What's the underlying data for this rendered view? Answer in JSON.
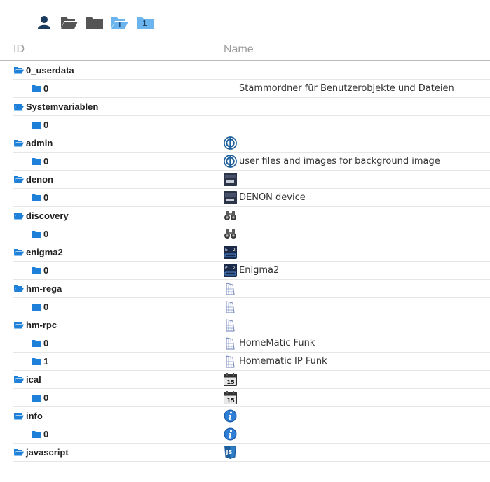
{
  "toolbar": {
    "buttons": [
      {
        "icon": "user-icon"
      },
      {
        "icon": "folder-open-icon"
      },
      {
        "icon": "folder-icon"
      },
      {
        "icon": "folder-open-icon"
      },
      {
        "icon": "folder-icon",
        "label": "1"
      }
    ]
  },
  "columns": {
    "id": "ID",
    "name": "Name"
  },
  "colors": {
    "folder_blue": "#1e80d8",
    "dark_folder": "#555555",
    "light_folder": "#6bb4ee"
  },
  "rows": [
    {
      "id": "0_userdata",
      "level": 0,
      "icon": "",
      "name": ""
    },
    {
      "id": "0",
      "level": 1,
      "icon": "",
      "name": "Stammordner für Benutzerobjekte und Dateien"
    },
    {
      "id": "Systemvariablen",
      "level": 0,
      "icon": "",
      "name": ""
    },
    {
      "id": "0",
      "level": 1,
      "icon": "",
      "name": ""
    },
    {
      "id": "admin",
      "level": 0,
      "icon": "admin-icon",
      "name": ""
    },
    {
      "id": "0",
      "level": 1,
      "icon": "admin-icon",
      "name": "user files and images for background image"
    },
    {
      "id": "denon",
      "level": 0,
      "icon": "denon-icon",
      "name": ""
    },
    {
      "id": "0",
      "level": 1,
      "icon": "denon-icon",
      "name": "DENON device"
    },
    {
      "id": "discovery",
      "level": 0,
      "icon": "binoculars-icon",
      "name": ""
    },
    {
      "id": "0",
      "level": 1,
      "icon": "binoculars-icon",
      "name": ""
    },
    {
      "id": "enigma2",
      "level": 0,
      "icon": "enigma2-icon",
      "name": ""
    },
    {
      "id": "0",
      "level": 1,
      "icon": "enigma2-icon",
      "name": "Enigma2"
    },
    {
      "id": "hm-rega",
      "level": 0,
      "icon": "homematic-icon",
      "name": ""
    },
    {
      "id": "0",
      "level": 1,
      "icon": "homematic-icon",
      "name": ""
    },
    {
      "id": "hm-rpc",
      "level": 0,
      "icon": "homematic-icon",
      "name": ""
    },
    {
      "id": "0",
      "level": 1,
      "icon": "homematic-icon",
      "name": "HomeMatic Funk"
    },
    {
      "id": "1",
      "level": 1,
      "icon": "homematic-icon",
      "name": "Homematic IP Funk"
    },
    {
      "id": "ical",
      "level": 0,
      "icon": "calendar-icon",
      "name": ""
    },
    {
      "id": "0",
      "level": 1,
      "icon": "calendar-icon",
      "name": ""
    },
    {
      "id": "info",
      "level": 0,
      "icon": "info-icon",
      "name": ""
    },
    {
      "id": "0",
      "level": 1,
      "icon": "info-icon",
      "name": ""
    },
    {
      "id": "javascript",
      "level": 0,
      "icon": "javascript-icon",
      "name": ""
    }
  ]
}
